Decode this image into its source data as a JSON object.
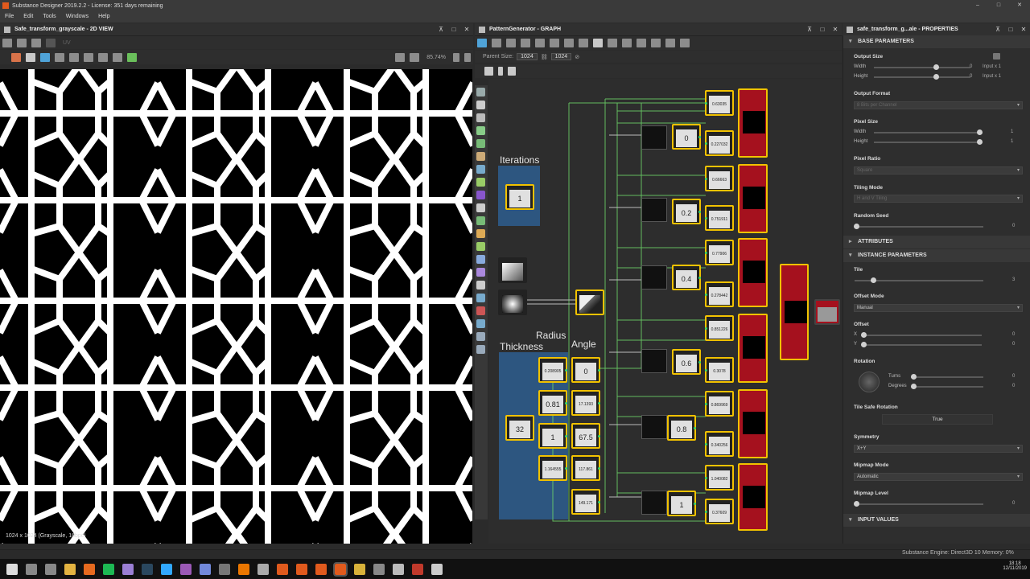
{
  "window": {
    "title": "Substance Designer 2019.2.2 - License: 351 days remaining",
    "controls": [
      "–",
      "□",
      "✕"
    ]
  },
  "menu": [
    "File",
    "Edit",
    "Tools",
    "Windows",
    "Help"
  ],
  "view2d": {
    "title": "Safe_transform_grayscale - 2D VIEW",
    "zoom": "85.74%",
    "status": "1024 x 1024 (Grayscale, 16bpc)",
    "channel": "UV"
  },
  "graph": {
    "title": "PatternGenerator - GRAPH",
    "parent_size_label": "Parent Size:",
    "parent_size_value": "1024",
    "size_value": "1024",
    "frames": {
      "iterations": "Iterations",
      "thickness": "Thickness",
      "radius": "Radius",
      "angle": "Angle"
    },
    "iteration_value": "1",
    "thickness_value": "32",
    "radius_values": [
      "0.208905",
      "0.81",
      "1",
      "1.164555"
    ],
    "angle_values": [
      "0",
      "17.1393",
      "67.5",
      "117.861",
      "149.171"
    ],
    "mid_values": [
      "0",
      "0.2",
      "0.4",
      "0.6",
      "0.8",
      "1"
    ],
    "right_values": [
      "0.63035",
      "0.227032",
      "0.66663",
      "0.751911",
      "0.77906",
      "0.278442",
      "0.851226",
      "0.3078",
      "0.869969",
      "0.340256",
      "1.040082",
      "0.37609"
    ]
  },
  "properties": {
    "title": "safe_transform_g...ale - PROPERTIES",
    "sections": {
      "base": "BASE PARAMETERS",
      "attributes": "ATTRIBUTES",
      "instance": "INSTANCE PARAMETERS",
      "input_values": "INPUT VALUES"
    },
    "output_size": {
      "label": "Output Size",
      "width": "Width",
      "height": "Height",
      "wval": "0",
      "hval": "0",
      "wunit": "Input x 1",
      "hunit": "Input x 1"
    },
    "output_format": {
      "label": "Output Format",
      "value": "8 Bits per Channel"
    },
    "pixel_size": {
      "label": "Pixel Size",
      "width": "Width",
      "height": "Height",
      "wval": "1",
      "hval": "1"
    },
    "pixel_ratio": {
      "label": "Pixel Ratio",
      "value": "Square"
    },
    "tiling_mode": {
      "label": "Tiling Mode",
      "value": "H and V Tiling"
    },
    "random_seed": {
      "label": "Random Seed",
      "value": "0"
    },
    "tile": {
      "label": "Tile",
      "value": "3"
    },
    "offset_mode": {
      "label": "Offset Mode",
      "value": "Manual"
    },
    "offset": {
      "label": "Offset",
      "x": "X",
      "y": "Y",
      "xval": "0",
      "yval": "0"
    },
    "rotation": {
      "label": "Rotation",
      "turns": "Turns",
      "degrees": "Degrees",
      "tval": "0",
      "dval": "0"
    },
    "tile_safe": {
      "label": "Tile Safe Rotation",
      "value": "True"
    },
    "symmetry": {
      "label": "Symmetry",
      "value": "X+Y"
    },
    "mipmap_mode": {
      "label": "Mipmap Mode",
      "value": "Automatic"
    },
    "mipmap_level": {
      "label": "Mipmap Level",
      "value": "0"
    }
  },
  "status": {
    "engine": "Substance Engine: Direct3D 10  Memory: 0%"
  },
  "taskbar": {
    "time": "18:18",
    "date": "12/11/2019"
  }
}
